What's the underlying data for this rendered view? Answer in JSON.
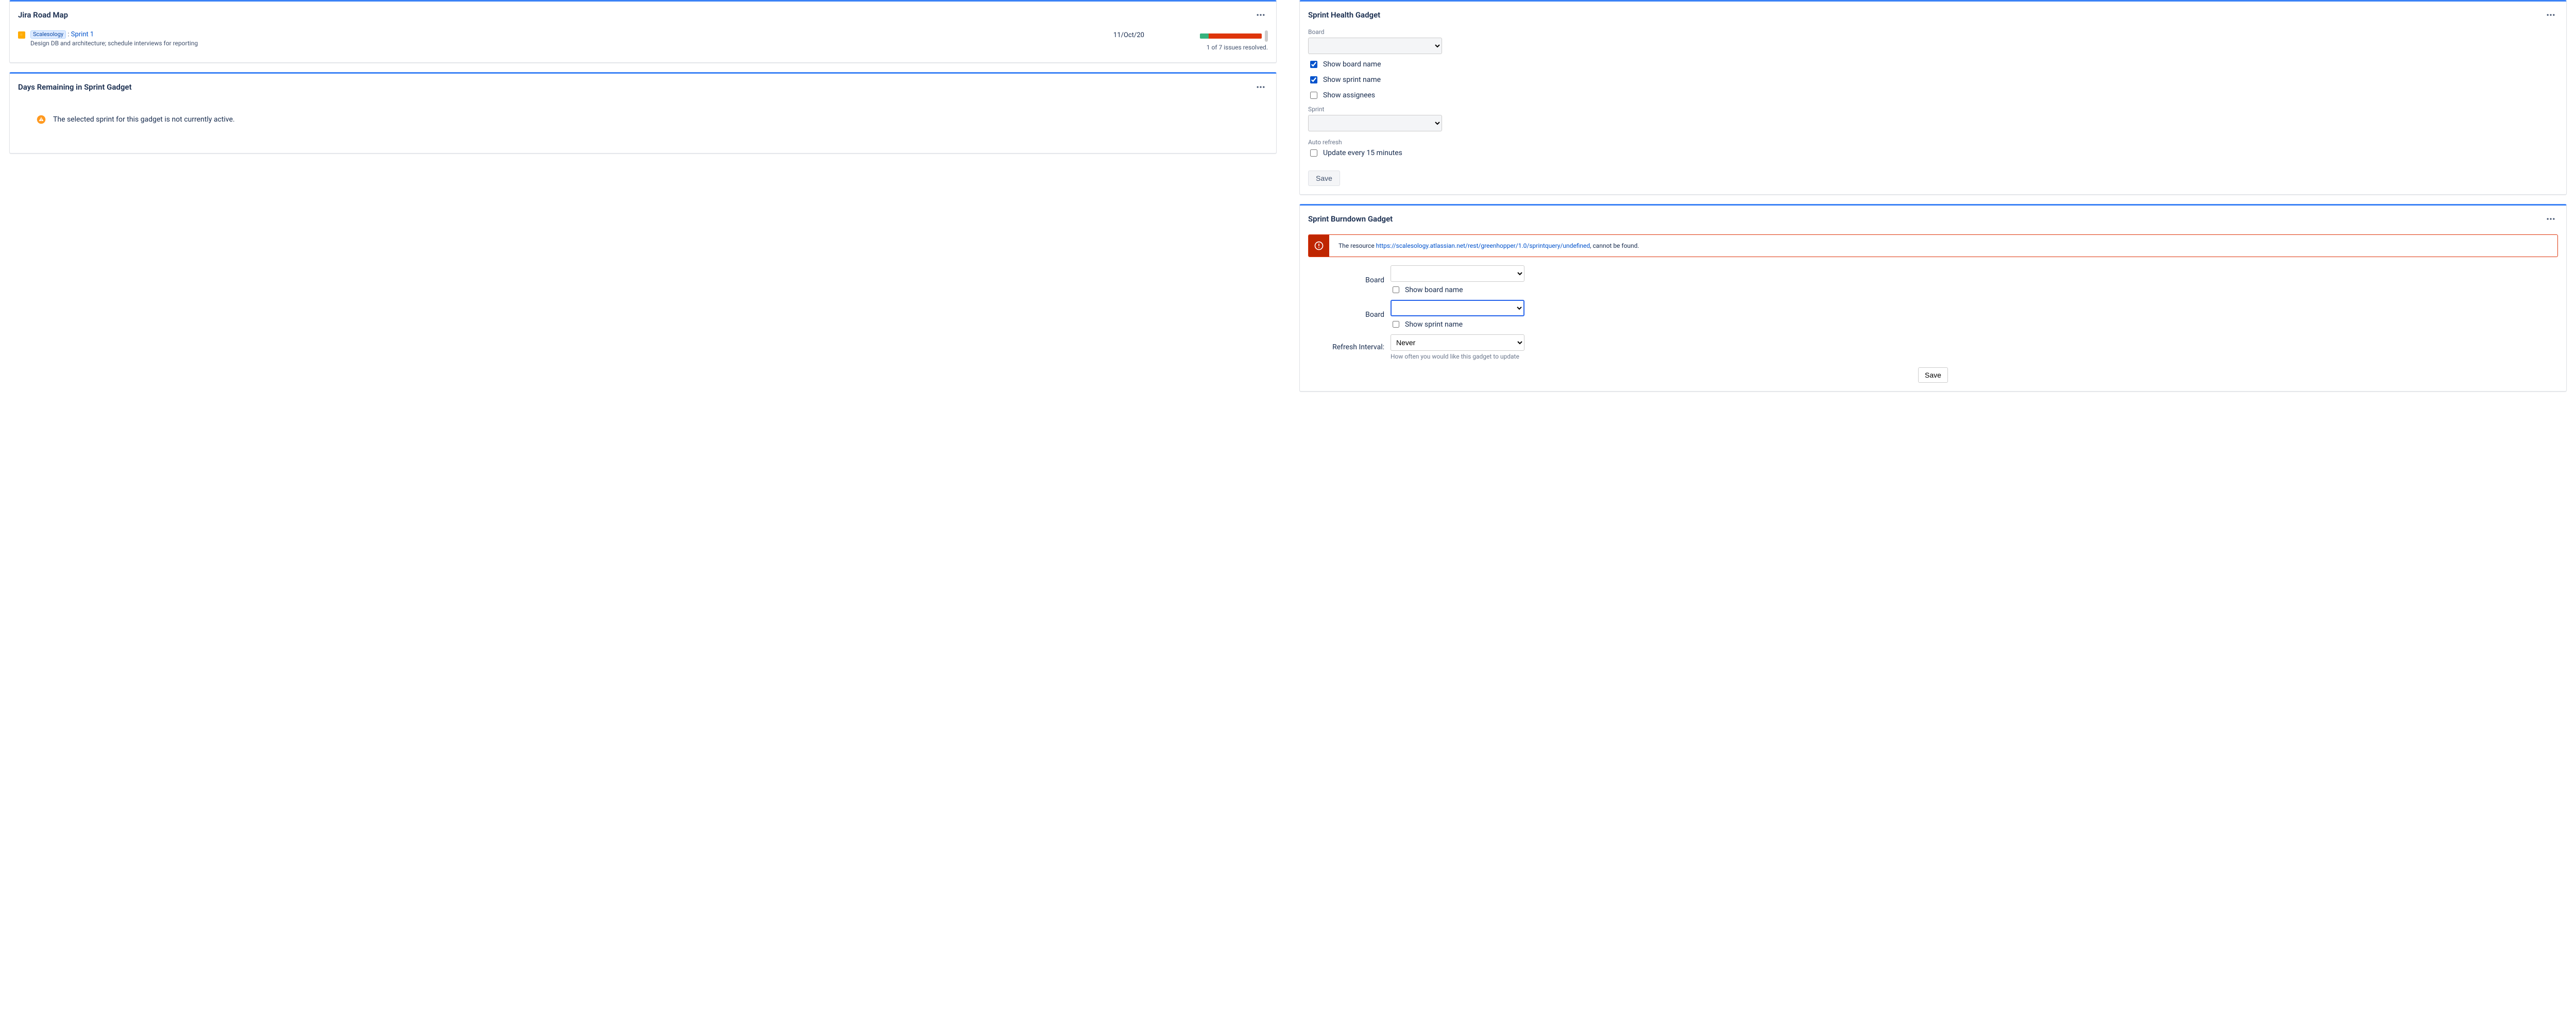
{
  "roadmap": {
    "title": "Jira Road Map",
    "project_lozenge": "Scalesology",
    "sprint_link": "Sprint 1",
    "description": "Design DB and architecture; schedule interviews for reporting",
    "date": "11/Oct/20",
    "resolved_text": "1 of 7 issues resolved.",
    "progress_done_pct": 14,
    "progress_remain_pct": 86
  },
  "days_remaining": {
    "title": "Days Remaining in Sprint Gadget",
    "message": "The selected sprint for this gadget is not currently active."
  },
  "sprint_health": {
    "title": "Sprint Health Gadget",
    "board_label": "Board",
    "show_board_name": {
      "label": "Show board name",
      "checked": true
    },
    "show_sprint_name": {
      "label": "Show sprint name",
      "checked": true
    },
    "show_assignees": {
      "label": "Show assignees",
      "checked": false
    },
    "sprint_label": "Sprint",
    "auto_refresh_label": "Auto refresh",
    "update_every": {
      "label": "Update every 15 minutes",
      "checked": false
    },
    "save_label": "Save"
  },
  "burndown": {
    "title": "Sprint Burndown Gadget",
    "error_prefix": "The resource ",
    "error_url": "https://scalesology.atlassian.net/rest/greenhopper/1.0/sprintquery/undefined",
    "error_suffix": ", cannot be found.",
    "board_label": "Board",
    "show_board_name": {
      "label": "Show board name",
      "checked": false
    },
    "board_label2": "Board",
    "show_sprint_name": {
      "label": "Show sprint name",
      "checked": false
    },
    "refresh_label": "Refresh Interval:",
    "refresh_value": "Never",
    "refresh_help": "How often you would like this gadget to update",
    "save_label": "Save"
  }
}
